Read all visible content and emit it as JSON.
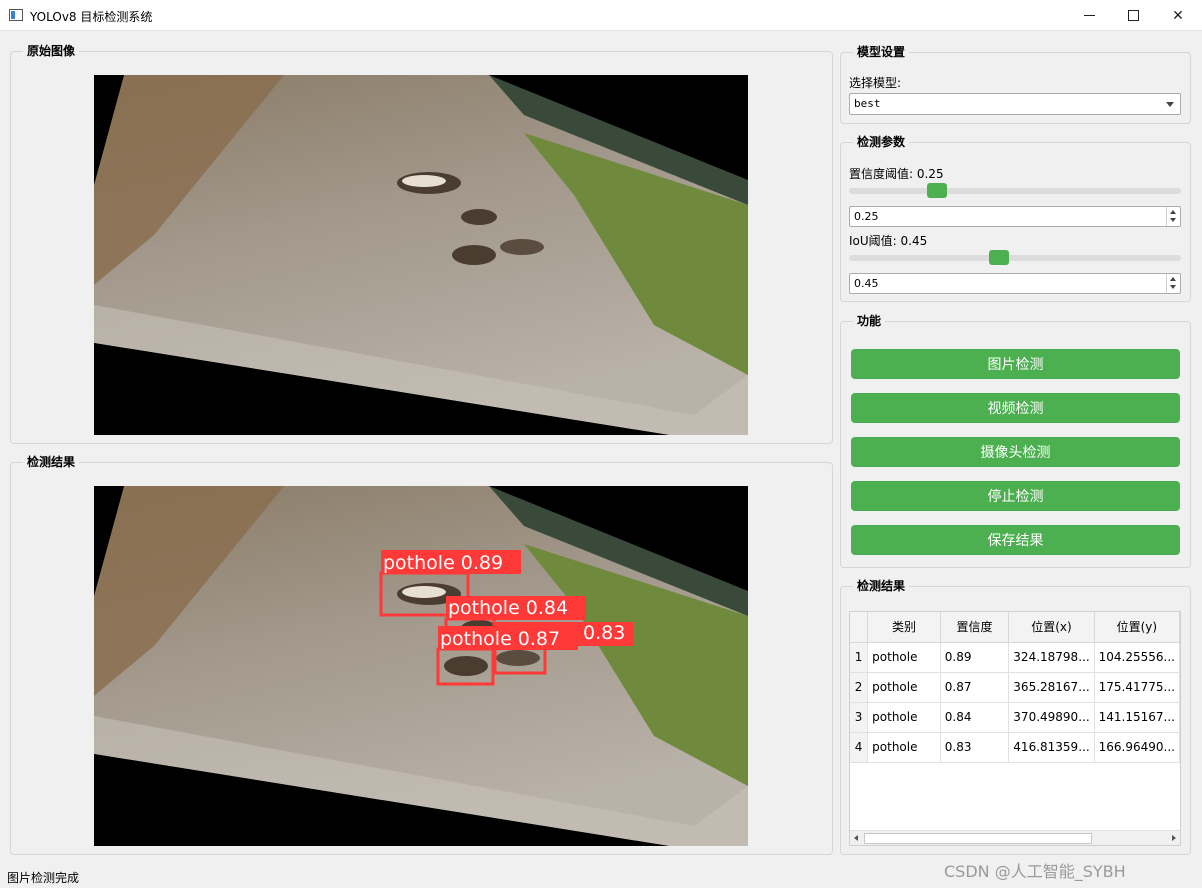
{
  "window": {
    "title": "YOLOv8 目标检测系统"
  },
  "original_panel": {
    "title": "原始图像"
  },
  "result_panel": {
    "title": "检测结果"
  },
  "detections_overlay": [
    {
      "label": "pothole 0.89"
    },
    {
      "label": "pothole 0.84"
    },
    {
      "label": "pothole 0.87"
    },
    {
      "label": "0.83"
    }
  ],
  "model_settings": {
    "title": "模型设置",
    "select_label": "选择模型:",
    "selected_model": "best"
  },
  "detect_params": {
    "title": "检测参数",
    "confidence_label": "置信度阈值: 0.25",
    "confidence_value": 0.25,
    "confidence_text": "0.25",
    "iou_label": "IoU阈值: 0.45",
    "iou_value": 0.45,
    "iou_text": "0.45"
  },
  "functions": {
    "title": "功能",
    "buttons": [
      "图片检测",
      "视频检测",
      "摄像头检测",
      "停止检测",
      "保存结果"
    ],
    "button_color": "#4CAF50"
  },
  "results_table": {
    "title": "检测结果",
    "headers": [
      "类别",
      "置信度",
      "位置(x)",
      "位置(y)"
    ],
    "rows": [
      {
        "n": "1",
        "cls": "pothole",
        "conf": "0.89",
        "x": "324.18798...",
        "y": "104.25556..."
      },
      {
        "n": "2",
        "cls": "pothole",
        "conf": "0.87",
        "x": "365.28167...",
        "y": "175.41775..."
      },
      {
        "n": "3",
        "cls": "pothole",
        "conf": "0.84",
        "x": "370.49890...",
        "y": "141.15167..."
      },
      {
        "n": "4",
        "cls": "pothole",
        "conf": "0.83",
        "x": "416.81359...",
        "y": "166.96490..."
      }
    ]
  },
  "status_bar": {
    "text": "图片检测完成"
  },
  "watermark": "CSDN @人工智能_SYBH"
}
